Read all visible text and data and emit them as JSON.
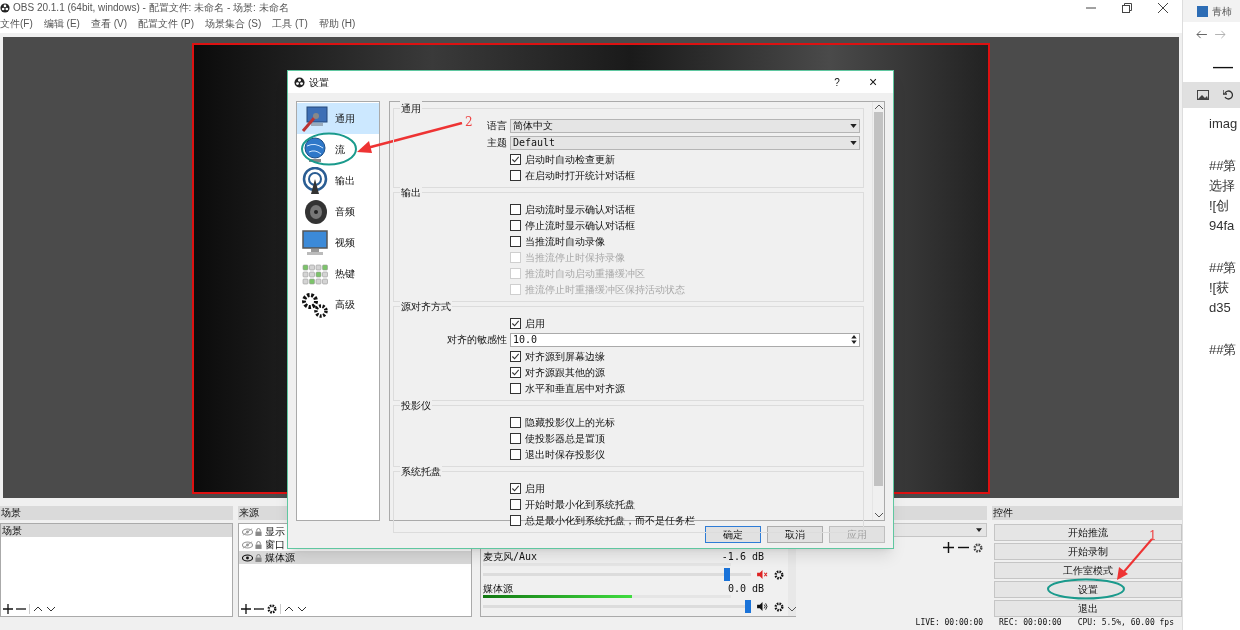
{
  "window": {
    "title": "OBS 20.1.1 (64bit, windows) - 配置文件: 未命名 - 场景: 未命名"
  },
  "menu": [
    "文件(F)",
    "编辑 (E)",
    "查看 (V)",
    "配置文件 (P)",
    "场景集合 (S)",
    "工具 (T)",
    "帮助 (H)"
  ],
  "scenes": {
    "title": "场景",
    "items": [
      {
        "label": "场景",
        "selected": true
      }
    ]
  },
  "sources": {
    "title": "来源",
    "items": [
      {
        "label": "显示",
        "visible": false,
        "selected": false
      },
      {
        "label": "窗口",
        "visible": false,
        "selected": false
      },
      {
        "label": "媒体源",
        "visible": true,
        "selected": true
      }
    ]
  },
  "mixer": {
    "channels": [
      {
        "name": "麦克风/Aux",
        "reading": "-1.6 dB",
        "muted": true,
        "meter": {
          "level": 0
        },
        "volume": {
          "level": 0.92
        }
      },
      {
        "name": "媒体源",
        "reading": "0.0 dB",
        "muted": false,
        "meter": {
          "level": 0.6
        },
        "volume": {
          "level": 1.0
        }
      }
    ]
  },
  "controls": {
    "title": "控件",
    "buttons": [
      {
        "label": "开始推流",
        "circled": false
      },
      {
        "label": "开始录制",
        "circled": false
      },
      {
        "label": "工作室模式",
        "circled": false
      },
      {
        "label": "设置",
        "circled": true,
        "callout": "1"
      },
      {
        "label": "退出",
        "circled": false
      }
    ]
  },
  "status_bar": [
    "LIVE: 00:00:00",
    "REC: 00:00:00",
    "CPU: 5.5%, 60.00 fps"
  ],
  "settings_dialog": {
    "title": "设置",
    "help": "?",
    "close": "×",
    "sidebar": [
      {
        "label": "通用",
        "selected": true,
        "circled": false
      },
      {
        "label": "流",
        "selected": false,
        "circled": true,
        "callout": "2"
      },
      {
        "label": "输出",
        "selected": false,
        "circled": false
      },
      {
        "label": "音频",
        "selected": false,
        "circled": false
      },
      {
        "label": "视频",
        "selected": false,
        "circled": false
      },
      {
        "label": "热键",
        "selected": false,
        "circled": false
      },
      {
        "label": "高级",
        "selected": false,
        "circled": false
      }
    ],
    "sections": [
      {
        "title": "通用",
        "rows": [
          {
            "kind": "select",
            "label": "语言",
            "value": "简体中文"
          },
          {
            "kind": "select",
            "label": "主题",
            "value": "Default"
          },
          {
            "kind": "checkbox",
            "label": "启动时自动检查更新",
            "checked": true,
            "disabled": false
          },
          {
            "kind": "checkbox",
            "label": "在启动时打开统计对话框",
            "checked": false,
            "disabled": false
          }
        ]
      },
      {
        "title": "输出",
        "rows": [
          {
            "kind": "checkbox",
            "label": "启动流时显示确认对话框",
            "checked": false,
            "disabled": false
          },
          {
            "kind": "checkbox",
            "label": "停止流时显示确认对话框",
            "checked": false,
            "disabled": false
          },
          {
            "kind": "checkbox",
            "label": "当推流时自动录像",
            "checked": false,
            "disabled": false
          },
          {
            "kind": "checkbox",
            "label": "当推流停止时保持录像",
            "checked": false,
            "disabled": true
          },
          {
            "kind": "checkbox",
            "label": "推流时自动启动重播缓冲区",
            "checked": false,
            "disabled": true
          },
          {
            "kind": "checkbox",
            "label": "推流停止时重播缓冲区保持活动状态",
            "checked": false,
            "disabled": true
          }
        ]
      },
      {
        "title": "源对齐方式",
        "rows": [
          {
            "kind": "checkbox",
            "label": "启用",
            "checked": true,
            "disabled": false
          },
          {
            "kind": "spin",
            "label": "对齐的敏感性",
            "value": "10.0"
          },
          {
            "kind": "checkbox",
            "label": "对齐源到屏幕边缘",
            "checked": true,
            "disabled": false
          },
          {
            "kind": "checkbox",
            "label": "对齐源跟其他的源",
            "checked": true,
            "disabled": false
          },
          {
            "kind": "checkbox",
            "label": "水平和垂直居中对齐源",
            "checked": false,
            "disabled": false
          }
        ]
      },
      {
        "title": "投影仪",
        "rows": [
          {
            "kind": "checkbox",
            "label": "隐藏投影仪上的光标",
            "checked": false,
            "disabled": false
          },
          {
            "kind": "checkbox",
            "label": "使投影器总是置顶",
            "checked": false,
            "disabled": false
          },
          {
            "kind": "checkbox",
            "label": "退出时保存投影仪",
            "checked": false,
            "disabled": false
          }
        ]
      },
      {
        "title": "系统托盘",
        "rows": [
          {
            "kind": "checkbox",
            "label": "启用",
            "checked": true,
            "disabled": false
          },
          {
            "kind": "checkbox",
            "label": "开始时最小化到系统托盘",
            "checked": false,
            "disabled": false
          },
          {
            "kind": "checkbox",
            "label": "总是最小化到系统托盘，而不是任务栏",
            "checked": false,
            "disabled": false
          }
        ]
      }
    ],
    "buttons": [
      {
        "label": "确定",
        "default": true,
        "disabled": false
      },
      {
        "label": "取消",
        "default": false,
        "disabled": false
      },
      {
        "label": "应用",
        "default": false,
        "disabled": true
      }
    ]
  },
  "browser": {
    "tab": "青柿",
    "heading": "—",
    "paragraphs": [
      [
        "imag"
      ],
      [
        "##第",
        "选择",
        "![创",
        "94fa"
      ],
      [
        "##第",
        "![获",
        "d35"
      ],
      [
        "##第"
      ]
    ]
  }
}
